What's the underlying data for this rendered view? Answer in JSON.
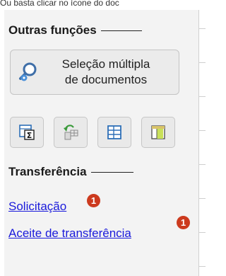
{
  "top_hint": "Ou basta clicar no ícone do doc",
  "sections": {
    "outras": {
      "title": "Outras funções"
    },
    "transferencia": {
      "title": "Transferência"
    }
  },
  "multi_select_button": {
    "label_line1": "Seleção múltipla",
    "label_line2": "de documentos",
    "icon": "magnifier-gear-icon"
  },
  "tools": [
    {
      "icon": "sum-document-icon"
    },
    {
      "icon": "undo-grid-icon"
    },
    {
      "icon": "table-grid-icon"
    },
    {
      "icon": "column-layout-icon"
    }
  ],
  "links": [
    {
      "label": "Solicitação",
      "badge": "1"
    },
    {
      "label": "Aceite de transferência",
      "badge": "1"
    }
  ],
  "colors": {
    "link": "#1a1adb",
    "badge": "#cc3a1e",
    "panel_bg": "#f3f3f3"
  }
}
